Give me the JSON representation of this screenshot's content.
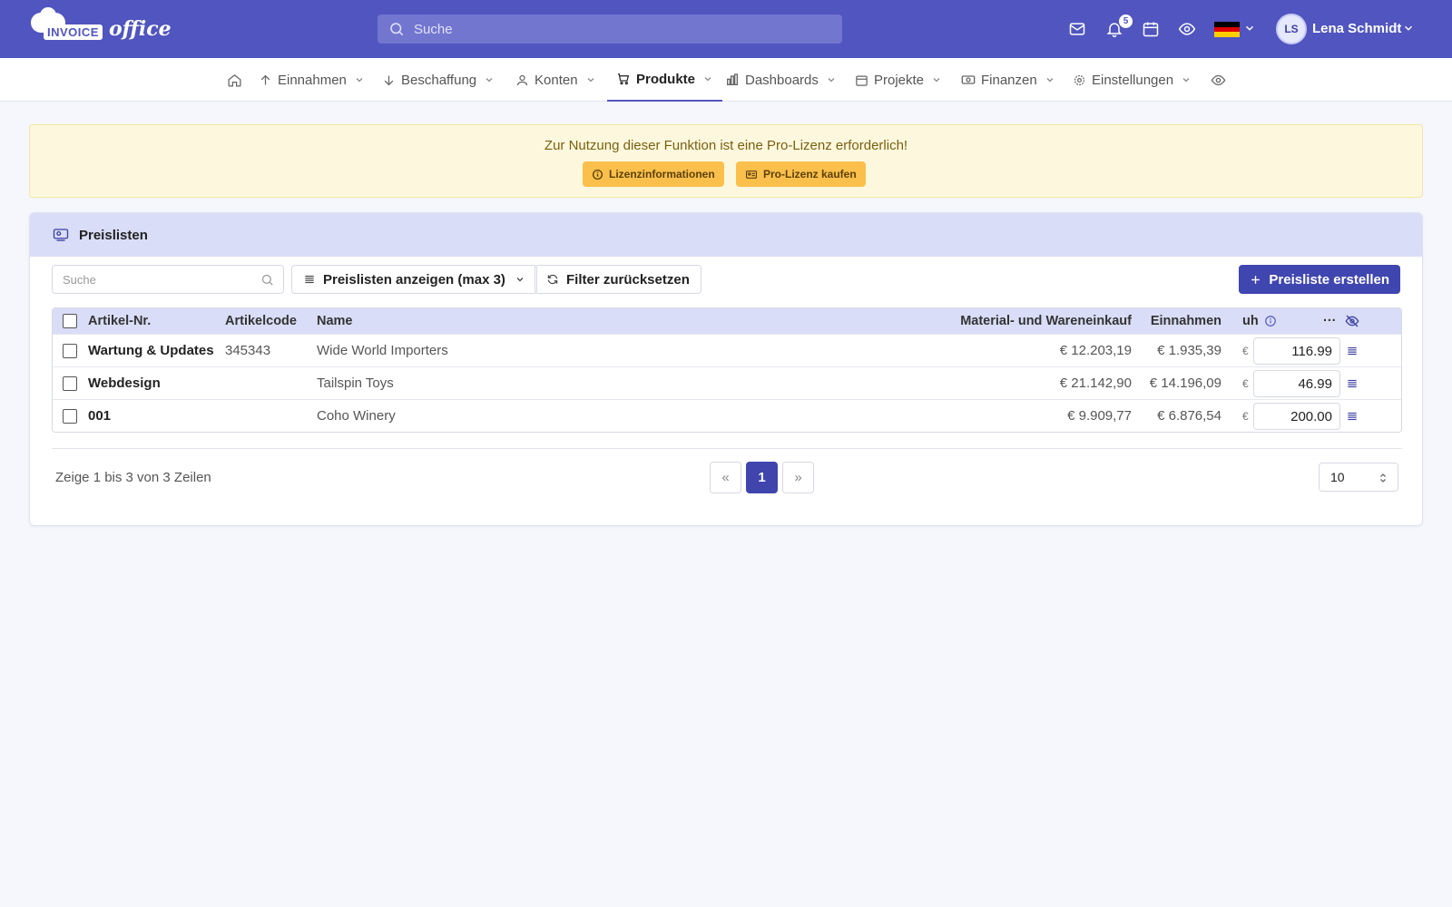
{
  "app": {
    "logo_box": "INVOICE",
    "logo_office": "office",
    "search_placeholder": "Suche",
    "notification_count": "5",
    "user_initials": "LS",
    "user_name": "Lena Schmidt"
  },
  "nav": {
    "items": [
      {
        "label": "Einnahmen"
      },
      {
        "label": "Beschaffung"
      },
      {
        "label": "Konten"
      },
      {
        "label": "Produkte"
      },
      {
        "label": "Dashboards"
      },
      {
        "label": "Projekte"
      },
      {
        "label": "Finanzen"
      },
      {
        "label": "Einstellungen"
      }
    ],
    "active": "Produkte"
  },
  "alert": {
    "message": "Zur Nutzung dieser Funktion ist eine Pro-Lizenz erforderlich!",
    "license_info_label": "Lizenzinformationen",
    "buy_label": "Pro-Lizenz kaufen"
  },
  "card": {
    "title": "Preislisten",
    "search_placeholder": "Suche",
    "view_select": "Preislisten anzeigen (max 3)",
    "reset_label": "Filter zurücksetzen",
    "create_label": "Preisliste erstellen"
  },
  "table": {
    "headers": {
      "article_no": "Artikel-Nr.",
      "article_code": "Artikelcode",
      "name": "Name",
      "purchase": "Material- und Wareneinkauf",
      "revenue": "Einnahmen",
      "uh": "uh",
      "more": "···"
    },
    "rows": [
      {
        "article_no": "Wartung & Updates",
        "article_code": "345343",
        "name": "Wide World Importers",
        "purchase": "€ 12.203,19",
        "revenue": "€ 1.935,39",
        "currency": "€",
        "price": "116.99"
      },
      {
        "article_no": "Webdesign",
        "article_code": "",
        "name": "Tailspin Toys",
        "purchase": "€ 21.142,90",
        "revenue": "€ 14.196,09",
        "currency": "€",
        "price": "46.99"
      },
      {
        "article_no": "001",
        "article_code": "",
        "name": "Coho Winery",
        "purchase": "€ 9.909,77",
        "revenue": "€ 6.876,54",
        "currency": "€",
        "price": "200.00"
      }
    ]
  },
  "footer": {
    "summary": "Zeige 1 bis 3 von 3 Zeilen",
    "prev": "«",
    "page": "1",
    "next": "»",
    "per_page": "10"
  },
  "colors": {
    "brand": "#5055bf",
    "primary_button": "#4046b0",
    "alert_bg": "#fdf8dd",
    "alert_button": "#fbbf4b",
    "table_head": "#d9ddf7"
  }
}
